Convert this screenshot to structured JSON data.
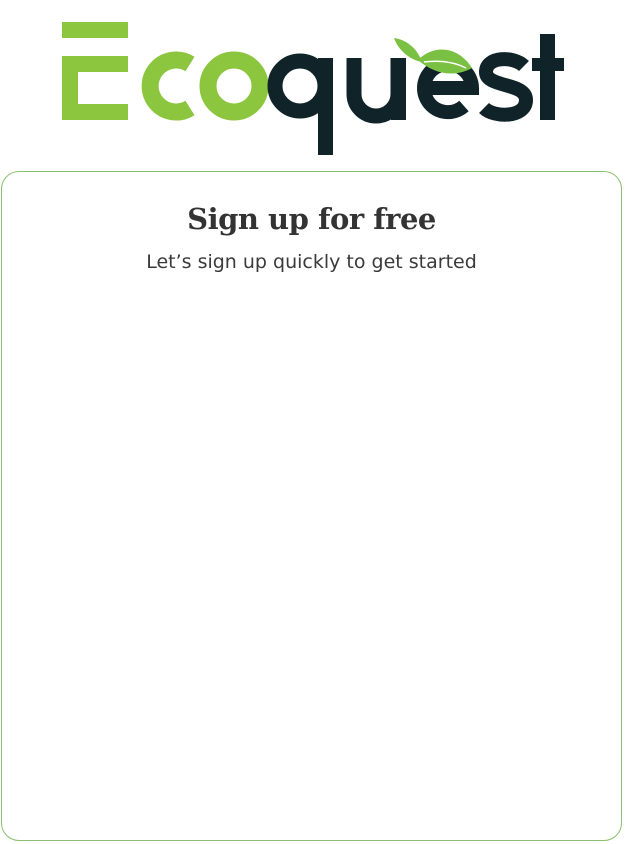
{
  "brand": {
    "name": "Ecoquest",
    "name_part_green": "Eco",
    "name_part_dark": "quest",
    "green_color": "#8cc63f",
    "dark_color": "#0f2329",
    "leaf_color": "#7ac143"
  },
  "signup": {
    "title": "Sign up for free",
    "subtitle": "Let’s sign up quickly to get started"
  },
  "colors": {
    "card_border": "#8cbf6e",
    "text": "#333333"
  }
}
